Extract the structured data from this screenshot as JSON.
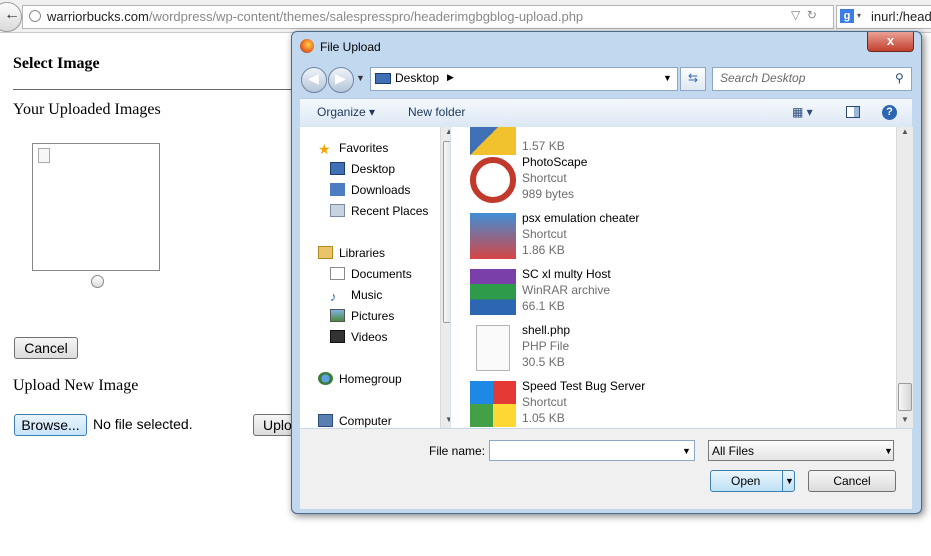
{
  "browser": {
    "url_domain": "warriorbucks.com",
    "url_path": "/wordpress/wp-content/themes/salespresspro/headerimgbgblog-upload.php",
    "search_engine_letter": "g",
    "search_text": "inurl:/heade"
  },
  "page": {
    "select_title": "Select Image",
    "uploaded_title": "Your Uploaded Images",
    "cancel_label": "Cancel",
    "upload_title": "Upload New Image",
    "browse_label": "Browse...",
    "no_file_text": "No file selected.",
    "upload_label": "Upload"
  },
  "dialog": {
    "title": "File Upload",
    "close_glyph": "x",
    "location": "Desktop",
    "search_placeholder": "Search Desktop",
    "toolbar": {
      "organize": "Organize ▾",
      "new_folder": "New folder"
    },
    "nav": {
      "favorites": "Favorites",
      "desktop": "Desktop",
      "downloads": "Downloads",
      "recent_places": "Recent Places",
      "libraries": "Libraries",
      "documents": "Documents",
      "music": "Music",
      "pictures": "Pictures",
      "videos": "Videos",
      "homegroup": "Homegroup",
      "computer": "Computer"
    },
    "files": [
      {
        "name": "",
        "type": "",
        "size": "1.57 KB"
      },
      {
        "name": "PhotoScape",
        "type": "Shortcut",
        "size": "989 bytes"
      },
      {
        "name": "psx emulation cheater",
        "type": "Shortcut",
        "size": "1.86 KB"
      },
      {
        "name": "SC xl multy Host",
        "type": "WinRAR archive",
        "size": "66.1 KB"
      },
      {
        "name": "shell.php",
        "type": "PHP File",
        "size": "30.5 KB"
      },
      {
        "name": "Speed Test Bug Server",
        "type": "Shortcut",
        "size": "1.05 KB"
      }
    ],
    "filename_label": "File name:",
    "filename_value": "",
    "filter_value": "All Files",
    "open_label": "Open",
    "cancel_label": "Cancel"
  }
}
